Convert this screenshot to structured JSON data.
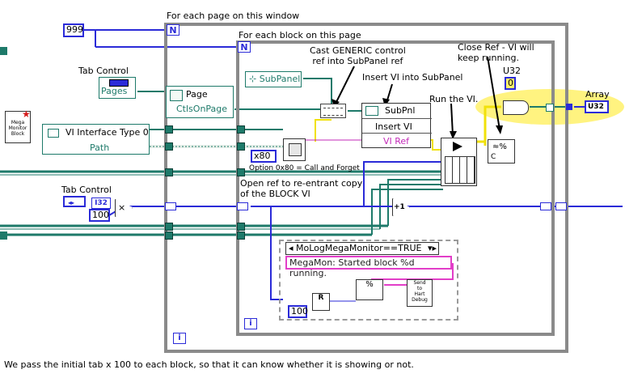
{
  "labels": {
    "outer_loop": "For each page on this window",
    "inner_loop": "For each block on this page",
    "tab_control_top": "Tab Control",
    "tab_control_bottom": "Tab Control",
    "cast_note": "Cast GENERIC control\nref into SubPanel ref",
    "insert_note": "Insert VI into SubPanel",
    "run_note": "Run the VI.",
    "close_note": "Close Ref - VI will\nkeep running.",
    "u32": "U32",
    "array": "Array",
    "open_ref_note": "Open ref to re-entrant copy\nof the BLOCK VI",
    "option_note": "Option 0x80 = Call and Forget",
    "footer": "We pass the initial tab x 100 to each block, so that it can know whether it is showing or not."
  },
  "constants": {
    "n_outer": "999",
    "hundred_top": "100",
    "hundred_bottom": "100",
    "x80": "x80",
    "zero": "0",
    "u32_type": "U32",
    "i32_type": "I32"
  },
  "nodes": {
    "subpanel": "SubPanel",
    "pages": "Pages",
    "page": "Page",
    "ctls_on_page": "CtlsOnPage",
    "vi_interface": "VI Interface Type 0",
    "path": "Path",
    "subpnl": "SubPnl",
    "insert_vi": "Insert VI",
    "vi_ref": "VI Ref",
    "case_selector": "MoLogMegaMonitor==TRUE",
    "megamon_string": "MegaMon: Started block %d running.",
    "mega_monitor": "Mega\nMonitor\nBlock",
    "send_hart": "Send\nto\nHart\nDebug",
    "loop_n": "N",
    "loop_i": "i",
    "plus_one": "+1"
  },
  "colors": {
    "loop_gray": "#8a8a8a",
    "wire_blue": "#2b2bd8",
    "wire_teal": "#1e7a6a",
    "wire_yellow": "#f1e10a",
    "wire_pink": "#e23ec8",
    "highlight": "#fff16a"
  }
}
